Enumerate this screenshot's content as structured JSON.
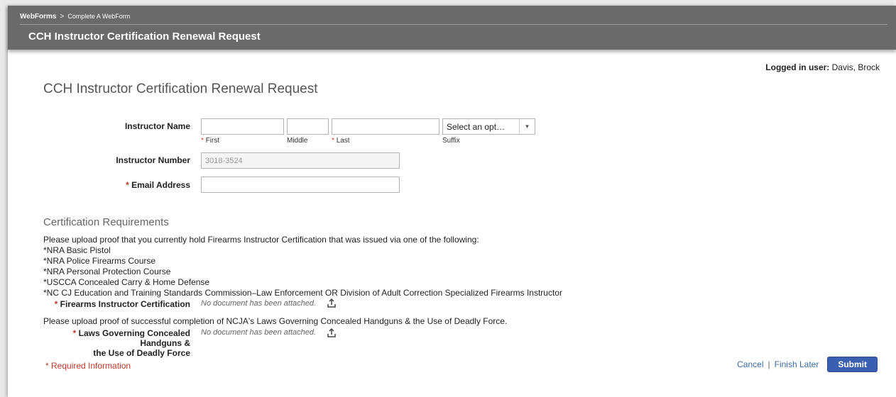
{
  "breadcrumb": {
    "home": "WebForms",
    "separator": ">",
    "current": "Complete A WebForm"
  },
  "header": {
    "title": "CCH Instructor Certification Renewal Request"
  },
  "user": {
    "label": "Logged in user:",
    "name": "Davis, Brock"
  },
  "form": {
    "title": "CCH Instructor Certification Renewal Request",
    "instructor_name": {
      "label": "Instructor Name",
      "first": {
        "value": "",
        "caption": "First"
      },
      "middle": {
        "value": "",
        "caption": "Middle"
      },
      "last": {
        "value": "",
        "caption": "Last"
      },
      "suffix": {
        "selected": "Select an opt…",
        "caption": "Suffix"
      }
    },
    "instructor_number": {
      "label": "Instructor Number",
      "value": "3018-3524"
    },
    "email": {
      "label": "Email Address",
      "value": ""
    }
  },
  "requirements": {
    "title": "Certification Requirements",
    "intro": "Please upload proof that you currently hold Firearms Instructor Certification that was issued via one of the following:",
    "items": [
      "*NRA Basic Pistol",
      "*NRA Police Firearms Course",
      "*NRA Personal Protection Course",
      "*USCCA Concealed Carry & Home Defense",
      "*NC CJ Education and Training Standards Commission–Law Enforcement OR Division of Adult Correction Specialized Firearms Instructor"
    ],
    "firearms_cert": {
      "label": "Firearms Instructor Certification",
      "status": "No document has been attached."
    },
    "laws_intro": "Please upload proof of successful completion of NCJA's Laws Governing Concealed Handguns & the Use of Deadly Force.",
    "laws_cert": {
      "label_line1": "Laws Governing Concealed Handguns &",
      "label_line2": "the Use of Deadly Force",
      "status": "No document has been attached."
    }
  },
  "footer": {
    "required_note": "Required Information",
    "cancel": "Cancel",
    "separator": "|",
    "finish_later": "Finish Later",
    "submit": "Submit"
  },
  "colors": {
    "header_bg": "#6a6a6a",
    "required": "#c0392b",
    "link": "#3a6ea5",
    "button": "#3a5fb0"
  },
  "icons": {
    "upload": "upload-icon",
    "dropdown": "chevron-down-icon"
  },
  "required_marker": "*"
}
